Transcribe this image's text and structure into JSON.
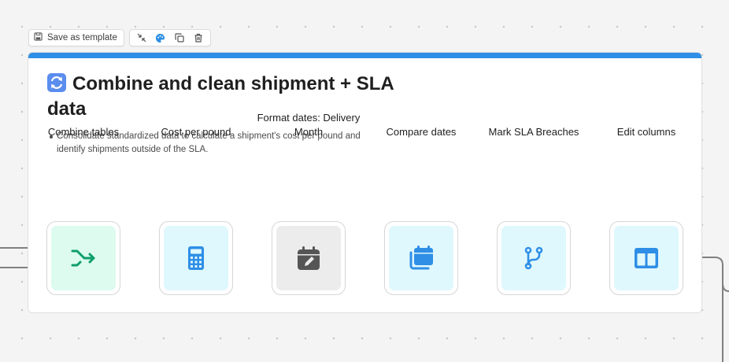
{
  "toolbar": {
    "save_label": "Save as template",
    "icons": [
      "collapse-icon",
      "palette-icon",
      "duplicate-icon",
      "trash-icon"
    ]
  },
  "card": {
    "accent_color": "#2f8fe6",
    "emoji": "arrows-cycle-icon",
    "title": "Combine and clean shipment + SLA data",
    "description": "Consolidate standardized data to calculate a shipment's cost per pound and identify shipments outside of the SLA."
  },
  "steps": [
    {
      "label": "Combine tables",
      "icon": "merge-icon",
      "color": "#0f9f6e",
      "bg": "#ddfbef"
    },
    {
      "label": "Cost per pound",
      "icon": "calculator-icon",
      "color": "#2f8fe6",
      "bg": "#dff8fd"
    },
    {
      "label": "Format dates: Delivery Month",
      "icon": "calendar-edit-icon",
      "color": "#555555",
      "bg": "#ececec"
    },
    {
      "label": "Compare dates",
      "icon": "calendar-compare-icon",
      "color": "#2f8fe6",
      "bg": "#dff8fd"
    },
    {
      "label": "Mark SLA Breaches",
      "icon": "branch-icon",
      "color": "#2f8fe6",
      "bg": "#dff8fd"
    },
    {
      "label": "Edit columns",
      "icon": "columns-icon",
      "color": "#2f8fe6",
      "bg": "#dff8fd"
    }
  ]
}
